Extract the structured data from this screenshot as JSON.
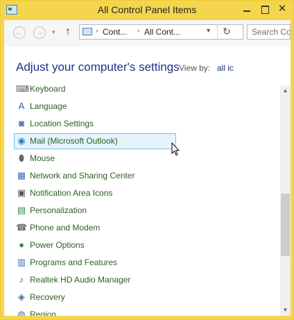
{
  "window": {
    "title": "All Control Panel Items",
    "close_glyph": "✕"
  },
  "nav": {
    "back_glyph": "←",
    "forward_glyph": "→",
    "recent_glyph": "▾",
    "up_glyph": "↑",
    "address": {
      "crumb1": "Cont...",
      "crumb2": "All Cont...",
      "sep": "›",
      "dropdown": "▾",
      "refresh": "↻"
    },
    "search_placeholder": "Search Co..."
  },
  "header": {
    "title": "Adjust your computer's settings",
    "view_by_label": "View by:",
    "view_by_value": "all ic"
  },
  "items": [
    {
      "label": "Keyboard",
      "icon": "keyboard-icon",
      "glyph": "⌨",
      "color": "#555555"
    },
    {
      "label": "Language",
      "icon": "language-icon",
      "glyph": "A",
      "color": "#2a5fb0"
    },
    {
      "label": "Location Settings",
      "icon": "location-icon",
      "glyph": "◙",
      "color": "#3a6fb5"
    },
    {
      "label": "Mail (Microsoft Outlook)",
      "icon": "mail-icon",
      "glyph": "◉",
      "color": "#2d7bbf"
    },
    {
      "label": "Mouse",
      "icon": "mouse-icon",
      "glyph": "⬮",
      "color": "#666666"
    },
    {
      "label": "Network and Sharing Center",
      "icon": "network-icon",
      "glyph": "▦",
      "color": "#3a6fb5"
    },
    {
      "label": "Notification Area Icons",
      "icon": "notification-icon",
      "glyph": "▣",
      "color": "#555555"
    },
    {
      "label": "Personalization",
      "icon": "personalization-icon",
      "glyph": "▤",
      "color": "#2f8c3a"
    },
    {
      "label": "Phone and Modem",
      "icon": "phone-icon",
      "glyph": "☎",
      "color": "#666666"
    },
    {
      "label": "Power Options",
      "icon": "power-icon",
      "glyph": "●",
      "color": "#2f8c3a"
    },
    {
      "label": "Programs and Features",
      "icon": "programs-icon",
      "glyph": "▥",
      "color": "#3a6fb5"
    },
    {
      "label": "Realtek HD Audio Manager",
      "icon": "audio-icon",
      "glyph": "♪",
      "color": "#2d5fa8"
    },
    {
      "label": "Recovery",
      "icon": "recovery-icon",
      "glyph": "◈",
      "color": "#3a6fb5"
    },
    {
      "label": "Region",
      "icon": "region-icon",
      "glyph": "◍",
      "color": "#3a6fb5"
    }
  ],
  "selected_item": "Mail (Microsoft Outlook)",
  "scrollbar": {
    "up_glyph": "▲",
    "down_glyph": "▼"
  },
  "colors": {
    "title_bar": "#f4d64e",
    "heading": "#1e3287",
    "link": "#2c5f23",
    "selection": "#e5f3fb"
  }
}
